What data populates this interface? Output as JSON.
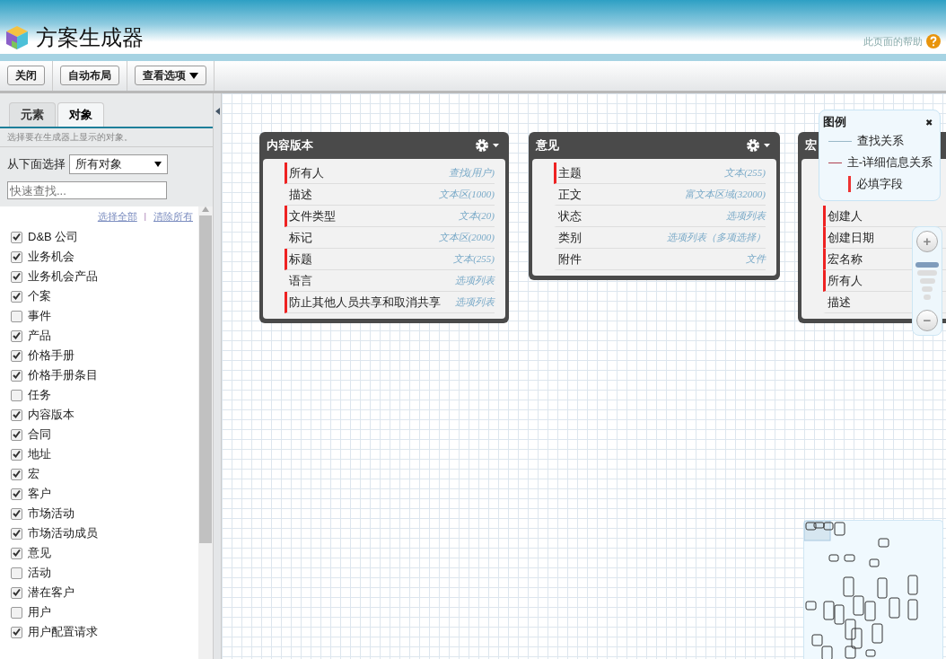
{
  "header": {
    "title": "方案生成器",
    "help_link": "此页面的帮助"
  },
  "toolbar": {
    "buttons": [
      {
        "label": "关闭",
        "kind": "plain"
      },
      {
        "label": "自动布局",
        "kind": "plain"
      },
      {
        "label": "查看选项",
        "kind": "dropdown"
      }
    ]
  },
  "sidebar": {
    "tabs": [
      {
        "label": "元素",
        "selected": false
      },
      {
        "label": "对象",
        "selected": true
      }
    ],
    "hint": "选择要在生成器上显示的对象。",
    "filter": {
      "label": "从下面选择",
      "value": "所有对象"
    },
    "search": {
      "placeholder": "快速查找..."
    },
    "select_all": "选择全部",
    "separator": "|",
    "clear_all": "清除所有",
    "objects": [
      {
        "label": "D&B 公司",
        "checked": true
      },
      {
        "label": "业务机会",
        "checked": true
      },
      {
        "label": "业务机会产品",
        "checked": true
      },
      {
        "label": "个案",
        "checked": true
      },
      {
        "label": "事件",
        "checked": false
      },
      {
        "label": "产品",
        "checked": true
      },
      {
        "label": "价格手册",
        "checked": true
      },
      {
        "label": "价格手册条目",
        "checked": true
      },
      {
        "label": "任务",
        "checked": false
      },
      {
        "label": "内容版本",
        "checked": true
      },
      {
        "label": "合同",
        "checked": true
      },
      {
        "label": "地址",
        "checked": true
      },
      {
        "label": "宏",
        "checked": true
      },
      {
        "label": "客户",
        "checked": true
      },
      {
        "label": "市场活动",
        "checked": true
      },
      {
        "label": "市场活动成员",
        "checked": true
      },
      {
        "label": "意见",
        "checked": true
      },
      {
        "label": "活动",
        "checked": false
      },
      {
        "label": "潜在客户",
        "checked": true
      },
      {
        "label": "用户",
        "checked": false
      },
      {
        "label": "用户配置请求",
        "checked": true
      }
    ]
  },
  "canvas": {
    "objects": [
      {
        "title": "内容版本",
        "menu": true,
        "fields": [
          {
            "name": "所有人",
            "type": "查找(用户)",
            "required": true
          },
          {
            "name": "描述",
            "type": "文本区(1000)",
            "required": false
          },
          {
            "name": "文件类型",
            "type": "文本(20)",
            "required": true
          },
          {
            "name": "标记",
            "type": "文本区(2000)",
            "required": false
          },
          {
            "name": "标题",
            "type": "文本(255)",
            "required": true
          },
          {
            "name": "语言",
            "type": "选项列表",
            "required": false
          },
          {
            "name": "防止其他人员共享和取消共享",
            "type": "选项列表",
            "required": true
          }
        ]
      },
      {
        "title": "意见",
        "menu": true,
        "fields": [
          {
            "name": "主题",
            "type": "文本(255)",
            "required": true
          },
          {
            "name": "正文",
            "type": "富文本区域(32000)",
            "required": false
          },
          {
            "name": "状态",
            "type": "选项列表",
            "required": false
          },
          {
            "name": "类别",
            "type": "选项列表（多项选择）",
            "required": false
          },
          {
            "name": "附件",
            "type": "文件",
            "required": false
          }
        ]
      },
      {
        "title": "宏",
        "menu": false,
        "fields": [
          {
            "name": "创建人",
            "required": true
          },
          {
            "name": "创建日期",
            "required": true
          },
          {
            "name": "宏名称",
            "required": true
          },
          {
            "name": "所有人",
            "required": true
          },
          {
            "name": "描述",
            "required": false
          }
        ]
      }
    ],
    "legend": {
      "title": "图例",
      "close": "✖",
      "items": [
        {
          "label": "查找关系",
          "kind": "lookup"
        },
        {
          "label": "主-详细信息关系",
          "kind": "master"
        },
        {
          "label": "必填字段",
          "kind": "required"
        }
      ]
    },
    "zoom": {
      "plus": "+",
      "minus": "−"
    }
  }
}
